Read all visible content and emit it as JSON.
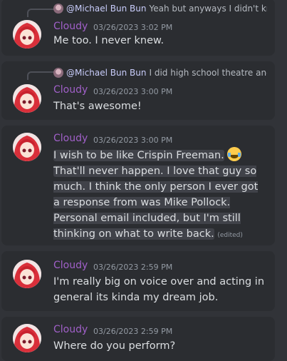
{
  "messages": [
    {
      "reply": {
        "mention": "@Michael Bun Bun",
        "text": "Yeah but anyways I didn't know that"
      },
      "username": "Cloudy",
      "timestamp": "03/26/2023 3:02 PM",
      "text": "Me too. I never knew."
    },
    {
      "reply": {
        "mention": "@Michael Bun Bun",
        "text": "I did high school theatre and"
      },
      "username": "Cloudy",
      "timestamp": "03/26/2023 3:00 PM",
      "text": "That's awesome!"
    },
    {
      "username": "Cloudy",
      "timestamp": "03/26/2023 3:00 PM",
      "text_part1": "I wish to be like Crispin Freeman.",
      "emoji": "laughing-tears-emoji",
      "text_part2": "That'll never happen. I love that guy so much. I think the only person I ever got a response from was Mike Pollock. Personal email included, but I'm still thinking on what to write back.",
      "edited": "(edited)"
    },
    {
      "username": "Cloudy",
      "timestamp": "03/26/2023 2:59 PM",
      "text": "I'm really big on voice over and acting in general its kinda my dream job."
    },
    {
      "username": "Cloudy",
      "timestamp": "03/26/2023 2:59 PM",
      "text": "Where do you perform?"
    }
  ],
  "colors": {
    "background": "#313338",
    "card": "#2b2d31",
    "username": "#a060c8",
    "mention": "#c9cdfb"
  }
}
